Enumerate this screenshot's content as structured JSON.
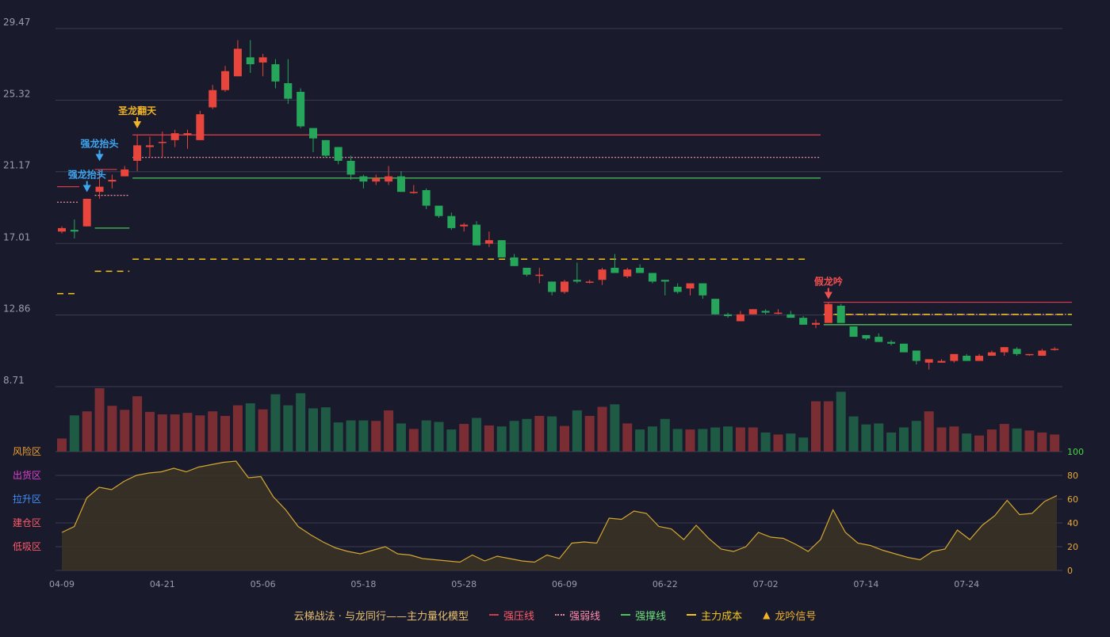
{
  "colors": {
    "background": "#191a2c",
    "up": "#e8453c",
    "down": "#26a65b",
    "vol_up": "#7a2e34",
    "vol_down": "#1f5a45",
    "grid": "#3a3c52",
    "axis_text": "#9a9cae",
    "pressure": "#d13b48",
    "weak": "#e08a9a",
    "support": "#4bc45a",
    "cost": "#f5c518",
    "signal": "#f0b429",
    "signal_blue": "#3ea6f0",
    "signal_red": "#f05050",
    "osc_line": "#d4a830",
    "osc_fill": "#3a3226",
    "zone_risk": "#f0a030",
    "zone_ship": "#e040d0",
    "zone_lift": "#4090ff",
    "zone_build": "#ff5a6a",
    "zone_absorb": "#ff5a6a",
    "right_axis_top": "#4bd34b"
  },
  "chart_data": [
    {
      "type": "candlestick",
      "price_axis": {
        "ticks": [
          "29.47",
          "25.32",
          "21.17",
          "17.01",
          "12.86",
          "8.71"
        ],
        "range": [
          8.71,
          29.47
        ]
      },
      "x_ticks": [
        {
          "index": 0,
          "label": "04-09"
        },
        {
          "index": 8,
          "label": "04-21"
        },
        {
          "index": 16,
          "label": "05-06"
        },
        {
          "index": 24,
          "label": "05-18"
        },
        {
          "index": 32,
          "label": "05-28"
        },
        {
          "index": 40,
          "label": "06-09"
        },
        {
          "index": 48,
          "label": "06-22"
        },
        {
          "index": 56,
          "label": "07-02"
        },
        {
          "index": 64,
          "label": "07-14"
        },
        {
          "index": 72,
          "label": "07-24"
        }
      ],
      "candles": [
        [
          17.7,
          17.9,
          17.6,
          18.0
        ],
        [
          17.8,
          17.7,
          17.3,
          18.4
        ],
        [
          18.0,
          19.6,
          18.0,
          19.6
        ],
        [
          20.0,
          20.3,
          19.6,
          21.2
        ],
        [
          20.6,
          20.7,
          20.2,
          21.0
        ],
        [
          20.9,
          21.3,
          20.9,
          21.5
        ],
        [
          21.8,
          22.7,
          21.2,
          23.3
        ],
        [
          22.6,
          22.7,
          22.0,
          23.2
        ],
        [
          22.9,
          22.9,
          22.0,
          23.5
        ],
        [
          23.0,
          23.4,
          22.6,
          23.6
        ],
        [
          23.3,
          23.4,
          22.5,
          23.6
        ],
        [
          23.0,
          24.5,
          23.0,
          24.7
        ],
        [
          24.9,
          25.9,
          24.8,
          26.2
        ],
        [
          25.9,
          27.0,
          25.8,
          27.3
        ],
        [
          26.7,
          28.3,
          26.7,
          28.8
        ],
        [
          27.8,
          27.4,
          26.9,
          28.8
        ],
        [
          27.5,
          27.8,
          26.7,
          28.0
        ],
        [
          27.4,
          26.4,
          26.0,
          27.7
        ],
        [
          26.3,
          25.4,
          25.1,
          27.7
        ],
        [
          25.8,
          23.8,
          23.7,
          26.0
        ],
        [
          23.7,
          23.1,
          22.3,
          23.7
        ],
        [
          23.0,
          22.1,
          22.0,
          23.0
        ],
        [
          22.6,
          21.8,
          21.6,
          22.6
        ],
        [
          21.8,
          21.0,
          20.7,
          22.1
        ],
        [
          20.9,
          20.6,
          20.2,
          21.0
        ],
        [
          20.6,
          20.8,
          20.4,
          21.0
        ],
        [
          20.6,
          20.9,
          20.4,
          21.5
        ],
        [
          20.9,
          20.0,
          20.0,
          21.2
        ],
        [
          20.0,
          20.0,
          19.9,
          20.4
        ],
        [
          20.1,
          19.2,
          19.0,
          20.2
        ],
        [
          19.2,
          18.6,
          18.5,
          19.2
        ],
        [
          18.6,
          17.9,
          17.8,
          18.8
        ],
        [
          18.0,
          18.1,
          17.7,
          18.2
        ],
        [
          18.1,
          16.9,
          16.9,
          18.3
        ],
        [
          17.0,
          17.2,
          16.8,
          17.7
        ],
        [
          17.2,
          16.2,
          16.2,
          17.2
        ],
        [
          16.2,
          15.7,
          15.7,
          16.4
        ],
        [
          15.6,
          15.2,
          15.1,
          15.6
        ],
        [
          15.2,
          15.2,
          14.7,
          15.6
        ],
        [
          14.8,
          14.2,
          14.0,
          14.8
        ],
        [
          14.2,
          14.8,
          14.1,
          14.9
        ],
        [
          14.9,
          14.8,
          14.7,
          15.9
        ],
        [
          14.8,
          14.8,
          14.7,
          14.9
        ],
        [
          14.9,
          15.5,
          14.6,
          15.6
        ],
        [
          15.6,
          15.3,
          15.3,
          16.4
        ],
        [
          15.1,
          15.5,
          15.0,
          15.6
        ],
        [
          15.6,
          15.3,
          15.3,
          15.8
        ],
        [
          15.3,
          14.8,
          14.7,
          15.3
        ],
        [
          14.9,
          14.8,
          14.0,
          14.9
        ],
        [
          14.5,
          14.2,
          14.1,
          14.7
        ],
        [
          14.4,
          14.7,
          14.0,
          14.7
        ],
        [
          14.7,
          14.0,
          13.8,
          14.7
        ],
        [
          13.8,
          12.9,
          12.9,
          13.8
        ],
        [
          12.9,
          12.8,
          12.7,
          13.0
        ],
        [
          12.5,
          12.9,
          12.5,
          13.1
        ],
        [
          12.9,
          13.2,
          12.9,
          13.2
        ],
        [
          13.1,
          13.0,
          12.9,
          13.2
        ],
        [
          13.0,
          13.0,
          12.9,
          13.2
        ],
        [
          12.9,
          12.7,
          12.7,
          13.1
        ],
        [
          12.7,
          12.3,
          12.3,
          12.8
        ],
        [
          12.3,
          12.4,
          12.1,
          12.6
        ],
        [
          12.4,
          13.5,
          12.4,
          13.6
        ],
        [
          13.4,
          12.4,
          12.4,
          13.5
        ],
        [
          12.2,
          11.6,
          11.6,
          12.2
        ],
        [
          11.7,
          11.5,
          11.4,
          11.7
        ],
        [
          11.6,
          11.3,
          11.3,
          11.8
        ],
        [
          11.3,
          11.2,
          11.1,
          11.4
        ],
        [
          11.2,
          10.7,
          10.7,
          11.2
        ],
        [
          10.8,
          10.2,
          10.0,
          10.8
        ],
        [
          10.1,
          10.3,
          9.7,
          10.3
        ],
        [
          10.1,
          10.2,
          10.1,
          10.3
        ],
        [
          10.2,
          10.6,
          10.1,
          10.6
        ],
        [
          10.5,
          10.2,
          10.2,
          10.6
        ],
        [
          10.2,
          10.5,
          10.2,
          10.6
        ],
        [
          10.5,
          10.7,
          10.5,
          10.8
        ],
        [
          10.7,
          11.0,
          10.5,
          11.0
        ],
        [
          10.9,
          10.6,
          10.5,
          11.0
        ],
        [
          10.6,
          10.6,
          10.5,
          10.6
        ],
        [
          10.5,
          10.8,
          10.5,
          10.9
        ],
        [
          10.9,
          10.9,
          10.8,
          11.0
        ]
      ],
      "levels": [
        {
          "kind": "pressure",
          "segments": [
            [
              0,
              1,
              20.3
            ],
            [
              3,
              4,
              21.3
            ],
            [
              6,
              60,
              23.3
            ],
            [
              61,
              80,
              13.6
            ]
          ]
        },
        {
          "kind": "weak",
          "segments": [
            [
              0,
              1,
              19.4
            ],
            [
              3,
              5,
              19.8
            ],
            [
              6,
              60,
              22.0
            ],
            [
              61,
              80,
              12.9
            ]
          ]
        },
        {
          "kind": "support",
          "segments": [
            [
              3,
              5,
              17.9
            ],
            [
              6,
              60,
              20.8
            ],
            [
              61,
              80,
              12.3
            ]
          ]
        },
        {
          "kind": "cost",
          "segments": [
            [
              0,
              1,
              14.1
            ],
            [
              3,
              5,
              15.4
            ],
            [
              6,
              59,
              16.1
            ],
            [
              61,
              80,
              12.9
            ]
          ]
        }
      ],
      "signals": [
        {
          "index": 2,
          "text": "强龙抬头",
          "color": "signal_blue",
          "price": 19.8
        },
        {
          "index": 3,
          "text": "强龙抬头",
          "color": "signal_blue",
          "price": 21.6
        },
        {
          "index": 6,
          "text": "圣龙翻天",
          "color": "signal",
          "price": 23.5
        },
        {
          "index": 61,
          "text": "假龙吟",
          "color": "signal_red",
          "price": 13.6
        }
      ]
    },
    {
      "type": "bar",
      "name": "volume",
      "values": [
        26,
        72,
        80,
        126,
        91,
        83,
        110,
        79,
        74,
        74,
        77,
        72,
        80,
        71,
        92,
        96,
        84,
        114,
        92,
        116,
        86,
        88,
        58,
        62,
        62,
        61,
        82,
        56,
        45,
        62,
        59,
        44,
        55,
        67,
        52,
        50,
        61,
        65,
        71,
        70,
        51,
        82,
        71,
        89,
        94,
        56,
        44,
        50,
        65,
        45,
        44,
        45,
        48,
        50,
        48,
        48,
        38,
        34,
        36,
        28,
        100,
        100,
        119,
        70,
        54,
        56,
        38,
        48,
        61,
        80,
        48,
        50,
        36,
        32,
        44,
        55,
        46,
        42,
        38,
        34
      ]
    },
    {
      "type": "area",
      "name": "oscillator",
      "y_ticks": [
        100,
        80,
        60,
        40,
        20,
        0
      ],
      "ylim": [
        0,
        100
      ],
      "zone_labels": [
        {
          "text": "风险区",
          "level": 80,
          "color": "zone_risk"
        },
        {
          "text": "出货区",
          "level": 60,
          "color": "zone_ship"
        },
        {
          "text": "拉升区",
          "level": 40,
          "color": "zone_lift"
        },
        {
          "text": "建仓区",
          "level": 20,
          "color": "zone_build"
        },
        {
          "text": "低吸区",
          "level": 0,
          "color": "zone_absorb"
        }
      ],
      "values": [
        32,
        37,
        61,
        70,
        68,
        75,
        80,
        82,
        83,
        86,
        83,
        87,
        89,
        91,
        92,
        78,
        79,
        62,
        51,
        37,
        30,
        24,
        19,
        16,
        14,
        17,
        20,
        14,
        13,
        10,
        9,
        8,
        7,
        13,
        8,
        12,
        10,
        8,
        7,
        13,
        10,
        23,
        24,
        23,
        44,
        43,
        50,
        48,
        37,
        35,
        26,
        38,
        27,
        18,
        16,
        20,
        32,
        28,
        27,
        22,
        16,
        26,
        51,
        32,
        23,
        21,
        17,
        14,
        11,
        9,
        16,
        18,
        34,
        26,
        38,
        46,
        59,
        47,
        48,
        58,
        63
      ]
    }
  ],
  "legend": {
    "title": "云梯战法 · 与龙同行——主力量化模型",
    "items": [
      {
        "label": "强压线",
        "color": "pressure",
        "style": "solid"
      },
      {
        "label": "强弱线",
        "color": "weak",
        "style": "dotted"
      },
      {
        "label": "强撑线",
        "color": "support",
        "style": "solid"
      },
      {
        "label": "主力成本",
        "color": "cost",
        "style": "dashed"
      },
      {
        "label": "龙吟信号",
        "color": "signal",
        "style": "triangle"
      }
    ]
  }
}
